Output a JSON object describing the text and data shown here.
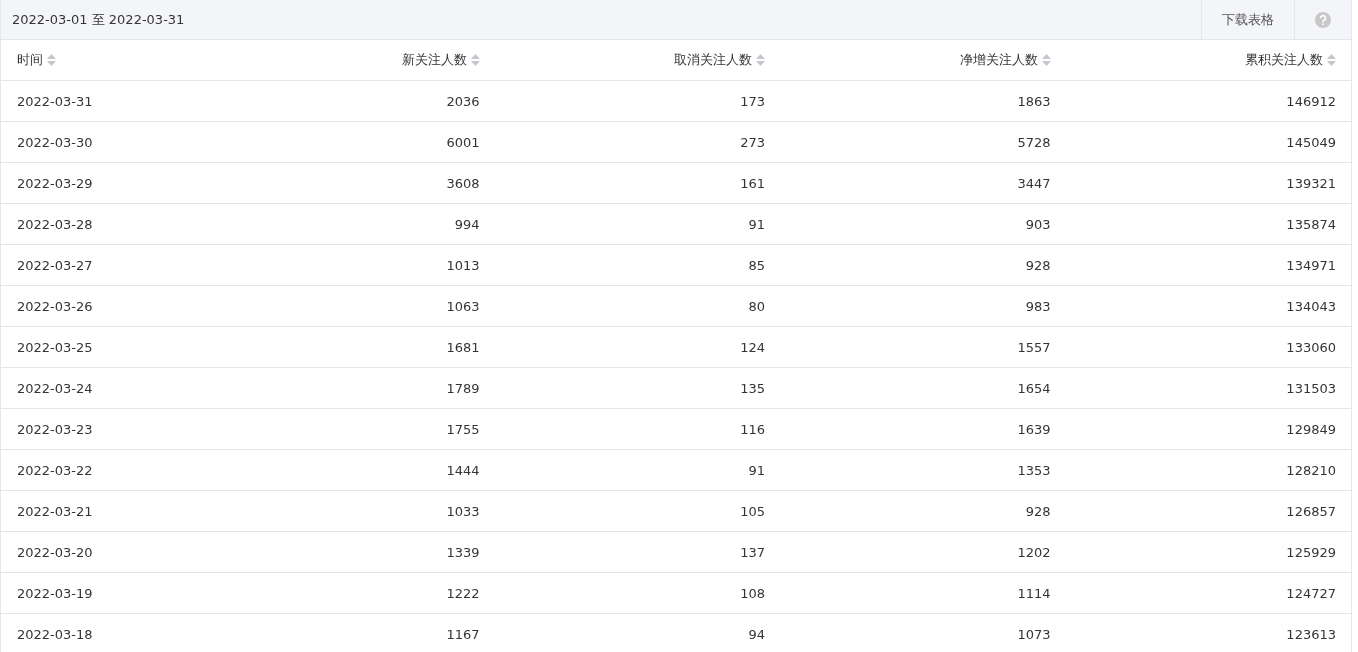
{
  "toolbar": {
    "date_range": "2022-03-01 至 2022-03-31",
    "download_button": "下载表格"
  },
  "table": {
    "columns": [
      "时间",
      "新关注人数",
      "取消关注人数",
      "净增关注人数",
      "累积关注人数"
    ],
    "rows": [
      [
        "2022-03-31",
        "2036",
        "173",
        "1863",
        "146912"
      ],
      [
        "2022-03-30",
        "6001",
        "273",
        "5728",
        "145049"
      ],
      [
        "2022-03-29",
        "3608",
        "161",
        "3447",
        "139321"
      ],
      [
        "2022-03-28",
        "994",
        "91",
        "903",
        "135874"
      ],
      [
        "2022-03-27",
        "1013",
        "85",
        "928",
        "134971"
      ],
      [
        "2022-03-26",
        "1063",
        "80",
        "983",
        "134043"
      ],
      [
        "2022-03-25",
        "1681",
        "124",
        "1557",
        "133060"
      ],
      [
        "2022-03-24",
        "1789",
        "135",
        "1654",
        "131503"
      ],
      [
        "2022-03-23",
        "1755",
        "116",
        "1639",
        "129849"
      ],
      [
        "2022-03-22",
        "1444",
        "91",
        "1353",
        "128210"
      ],
      [
        "2022-03-21",
        "1033",
        "105",
        "928",
        "126857"
      ],
      [
        "2022-03-20",
        "1339",
        "137",
        "1202",
        "125929"
      ],
      [
        "2022-03-19",
        "1222",
        "108",
        "1114",
        "124727"
      ],
      [
        "2022-03-18",
        "1167",
        "94",
        "1073",
        "123613"
      ]
    ]
  }
}
